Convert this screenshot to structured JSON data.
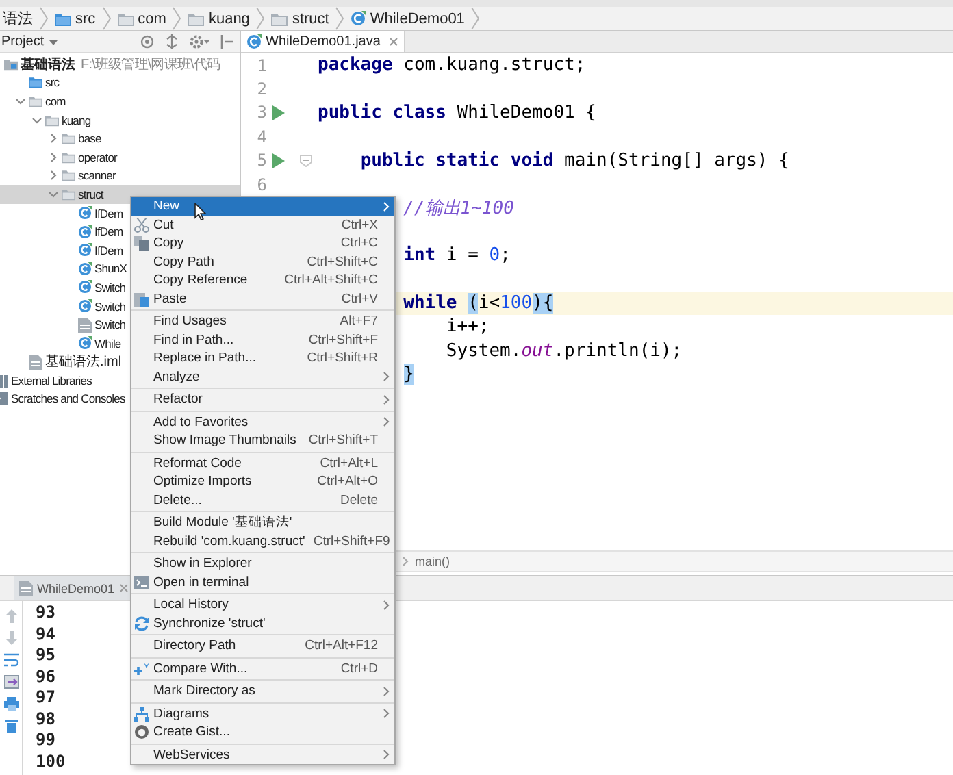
{
  "breadcrumbs": [
    {
      "label": "语法"
    },
    {
      "label": "src",
      "kind": "source"
    },
    {
      "label": "com",
      "kind": "folder"
    },
    {
      "label": "kuang",
      "kind": "folder"
    },
    {
      "label": "struct",
      "kind": "folder"
    },
    {
      "label": "WhileDemo01",
      "kind": "class"
    }
  ],
  "project": {
    "title": "Project",
    "tree": [
      {
        "label": "基础语法",
        "path": "F:\\班级管理\\网课班\\代码",
        "kind": "module",
        "selected": false,
        "children": [
          {
            "label": "src",
            "kind": "source",
            "selected": false
          },
          {
            "label": "com",
            "kind": "folder",
            "expanded": true,
            "selected": false,
            "children": [
              {
                "label": "kuang",
                "kind": "folder",
                "expanded": true,
                "selected": false,
                "children": [
                  {
                    "label": "base",
                    "kind": "folder",
                    "expanded": false,
                    "selected": false
                  },
                  {
                    "label": "operator",
                    "kind": "folder",
                    "expanded": false,
                    "selected": false
                  },
                  {
                    "label": "scanner",
                    "kind": "folder",
                    "expanded": false,
                    "selected": false
                  },
                  {
                    "label": "struct",
                    "kind": "folder",
                    "expanded": true,
                    "selected": true,
                    "children": [
                      {
                        "label": "IfDem",
                        "kind": "class",
                        "selected": false
                      },
                      {
                        "label": "IfDem",
                        "kind": "class",
                        "selected": false
                      },
                      {
                        "label": "IfDem",
                        "kind": "class",
                        "selected": false
                      },
                      {
                        "label": "ShunX",
                        "kind": "class",
                        "selected": false
                      },
                      {
                        "label": "Switch",
                        "kind": "class",
                        "selected": false
                      },
                      {
                        "label": "Switch",
                        "kind": "class",
                        "selected": false
                      },
                      {
                        "label": "Switch",
                        "kind": "file",
                        "selected": false
                      },
                      {
                        "label": "While",
                        "kind": "class",
                        "selected": false
                      }
                    ]
                  }
                ]
              }
            ]
          },
          {
            "label": "基础语法.iml",
            "kind": "iml",
            "selected": false
          }
        ]
      },
      {
        "label": "External Libraries",
        "kind": "library",
        "selected": false
      },
      {
        "label": "Scratches and Consoles",
        "kind": "scratch",
        "selected": false
      }
    ]
  },
  "editor": {
    "tabs": [
      {
        "label": "WhileDemo01.java",
        "kind": "class",
        "selected": true
      }
    ],
    "lines": [
      {
        "kind": "code",
        "number": "1",
        "tokens": [
          {
            "kind": "kw",
            "text": "package"
          },
          {
            "kind": "plain",
            "text": " com.kuang.struct;"
          }
        ]
      },
      {
        "kind": "code",
        "number": "2"
      },
      {
        "kind": "code",
        "number": "3",
        "run": true,
        "tokens": [
          {
            "kind": "kw",
            "text": "public class"
          },
          {
            "kind": "plain",
            "text": " WhileDemo01 {"
          }
        ]
      },
      {
        "kind": "code",
        "number": "4"
      },
      {
        "kind": "code",
        "number": "5",
        "run": true,
        "fold": true,
        "tokens": [
          {
            "kind": "kw",
            "text": "    public static void"
          },
          {
            "kind": "plain",
            "text": " main(String[] args) {"
          }
        ]
      },
      {
        "kind": "code",
        "number": "6"
      },
      {
        "kind": "code",
        "tokens": [
          {
            "kind": "comment",
            "text": "        //输出1~100"
          }
        ]
      },
      {
        "kind": "blank"
      },
      {
        "kind": "code",
        "tokens": [
          {
            "kind": "kw",
            "text": "        int"
          },
          {
            "kind": "plain",
            "text": " i = "
          },
          {
            "kind": "num",
            "text": "0"
          },
          {
            "kind": "plain",
            "text": ";"
          }
        ]
      },
      {
        "kind": "blank"
      },
      {
        "kind": "code",
        "current": true,
        "tokens": [
          {
            "kind": "kw",
            "text": "        while "
          },
          {
            "kind": "match",
            "text": "("
          },
          {
            "kind": "plain",
            "text": "i<"
          },
          {
            "kind": "num",
            "text": "100"
          },
          {
            "kind": "match",
            "text": "){"
          }
        ]
      },
      {
        "kind": "code",
        "tokens": [
          {
            "kind": "plain",
            "text": "            i++;"
          }
        ]
      },
      {
        "kind": "code",
        "tokens": [
          {
            "kind": "plain",
            "text": "            System."
          },
          {
            "kind": "field",
            "text": "out"
          },
          {
            "kind": "plain",
            "text": ".println(i);"
          }
        ]
      },
      {
        "kind": "code",
        "tokens": [
          {
            "kind": "match",
            "text": "        }"
          }
        ]
      }
    ],
    "breadcrumb": "main()"
  },
  "run": {
    "tabs": [
      {
        "label": "WhileDemo01",
        "kind": "file",
        "selected": true
      }
    ],
    "output": [
      "93",
      "94",
      "95",
      "96",
      "97",
      "98",
      "99",
      "100"
    ]
  },
  "menu": {
    "groups": [
      [
        {
          "label": "New",
          "submenu": true,
          "selected": true
        },
        {
          "label": "Cut",
          "shortcut": "Ctrl+X",
          "kind": "cut",
          "submenu": false,
          "selected": false
        },
        {
          "label": "Copy",
          "shortcut": "Ctrl+C",
          "kind": "copy",
          "submenu": false,
          "selected": false
        },
        {
          "label": "Copy Path",
          "shortcut": "Ctrl+Shift+C",
          "submenu": false,
          "selected": false
        },
        {
          "label": "Copy Reference",
          "shortcut": "Ctrl+Alt+Shift+C",
          "submenu": false,
          "selected": false
        },
        {
          "label": "Paste",
          "shortcut": "Ctrl+V",
          "kind": "paste",
          "submenu": false,
          "selected": false
        }
      ],
      [
        {
          "label": "Find Usages",
          "shortcut": "Alt+F7",
          "submenu": false,
          "selected": false
        },
        {
          "label": "Find in Path...",
          "shortcut": "Ctrl+Shift+F",
          "submenu": false,
          "selected": false
        },
        {
          "label": "Replace in Path...",
          "shortcut": "Ctrl+Shift+R",
          "submenu": false,
          "selected": false
        },
        {
          "label": "Analyze",
          "submenu": true,
          "selected": false
        }
      ],
      [
        {
          "label": "Refactor",
          "submenu": true,
          "selected": false
        }
      ],
      [
        {
          "label": "Add to Favorites",
          "submenu": true,
          "selected": false
        },
        {
          "label": "Show Image Thumbnails",
          "shortcut": "Ctrl+Shift+T",
          "submenu": false,
          "selected": false
        }
      ],
      [
        {
          "label": "Reformat Code",
          "shortcut": "Ctrl+Alt+L",
          "submenu": false,
          "selected": false
        },
        {
          "label": "Optimize Imports",
          "shortcut": "Ctrl+Alt+O",
          "submenu": false,
          "selected": false
        },
        {
          "label": "Delete...",
          "shortcut": "Delete",
          "submenu": false,
          "selected": false
        }
      ],
      [
        {
          "label": "Build Module '基础语法'",
          "submenu": false,
          "selected": false
        },
        {
          "label": "Rebuild 'com.kuang.struct'",
          "shortcut": "Ctrl+Shift+F9",
          "submenu": false,
          "selected": false
        }
      ],
      [
        {
          "label": "Show in Explorer",
          "submenu": false,
          "selected": false
        },
        {
          "label": "Open in terminal",
          "kind": "terminal",
          "submenu": false,
          "selected": false
        }
      ],
      [
        {
          "label": "Local History",
          "submenu": true,
          "selected": false
        },
        {
          "label": "Synchronize 'struct'",
          "kind": "sync",
          "submenu": false,
          "selected": false
        }
      ],
      [
        {
          "label": "Directory Path",
          "shortcut": "Ctrl+Alt+F12",
          "submenu": false,
          "selected": false
        }
      ],
      [
        {
          "label": "Compare With...",
          "shortcut": "Ctrl+D",
          "kind": "compare",
          "submenu": false,
          "selected": false
        }
      ],
      [
        {
          "label": "Mark Directory as",
          "submenu": true,
          "selected": false
        }
      ],
      [
        {
          "label": "Diagrams",
          "kind": "diagram",
          "submenu": true,
          "selected": false
        },
        {
          "label": "Create Gist...",
          "kind": "gist",
          "submenu": false,
          "selected": false
        }
      ],
      [
        {
          "label": "WebServices",
          "submenu": true,
          "selected": false
        }
      ]
    ]
  }
}
